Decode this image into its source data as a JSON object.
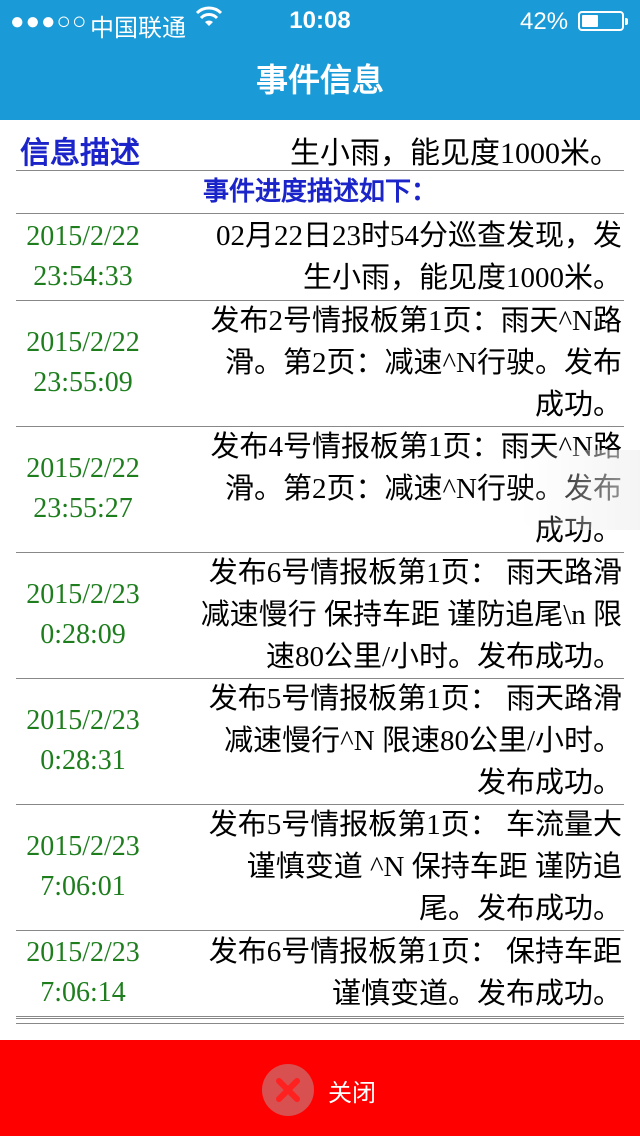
{
  "status_bar": {
    "signal": "●●●○○",
    "carrier": "中国联通",
    "wifi_icon": "wifi-icon",
    "time": "10:08",
    "battery_percent": "42%",
    "battery_level": 0.42
  },
  "header": {
    "title": "事件信息"
  },
  "info": {
    "label": "信息描述",
    "description": "生小雨，能见度1000米。"
  },
  "progress_title": "事件进度描述如下：",
  "events": [
    {
      "date": "2015/2/22",
      "time": "23:54:33",
      "lines": [
        "02月22日23时54分巡查发现，发",
        "生小雨，能见度1000米。"
      ]
    },
    {
      "date": "2015/2/22",
      "time": "23:55:09",
      "lines": [
        "发布2号情报板第1页：雨天^N路",
        "滑。第2页：减速^N行驶。发布",
        "成功。"
      ]
    },
    {
      "date": "2015/2/22",
      "time": "23:55:27",
      "lines": [
        "发布4号情报板第1页：雨天^N路",
        "滑。第2页：减速^N行驶。发布",
        "成功。"
      ]
    },
    {
      "date": "2015/2/23",
      "time": "0:28:09",
      "lines": [
        "发布6号情报板第1页： 雨天路滑",
        "减速慢行 保持车距 谨防追尾\\n 限",
        "速80公里/小时。发布成功。"
      ]
    },
    {
      "date": "2015/2/23",
      "time": "0:28:31",
      "lines": [
        "发布5号情报板第1页： 雨天路滑",
        "减速慢行^N 限速80公里/小时。",
        "发布成功。"
      ]
    },
    {
      "date": "2015/2/23",
      "time": "7:06:01",
      "lines": [
        "发布5号情报板第1页： 车流量大",
        "谨慎变道 ^N 保持车距 谨防追",
        "尾。发布成功。"
      ]
    },
    {
      "date": "2015/2/23",
      "time": "7:06:14",
      "lines": [
        "发布6号情报板第1页： 保持车距",
        "谨慎变道。发布成功。"
      ]
    }
  ],
  "footer": {
    "close_label": "关闭",
    "close_icon": "close-icon"
  },
  "colors": {
    "header_bg": "#1a9ad6",
    "footer_bg": "#ff0000",
    "label_blue": "#1b24c8",
    "time_green": "#1e7e1e"
  }
}
